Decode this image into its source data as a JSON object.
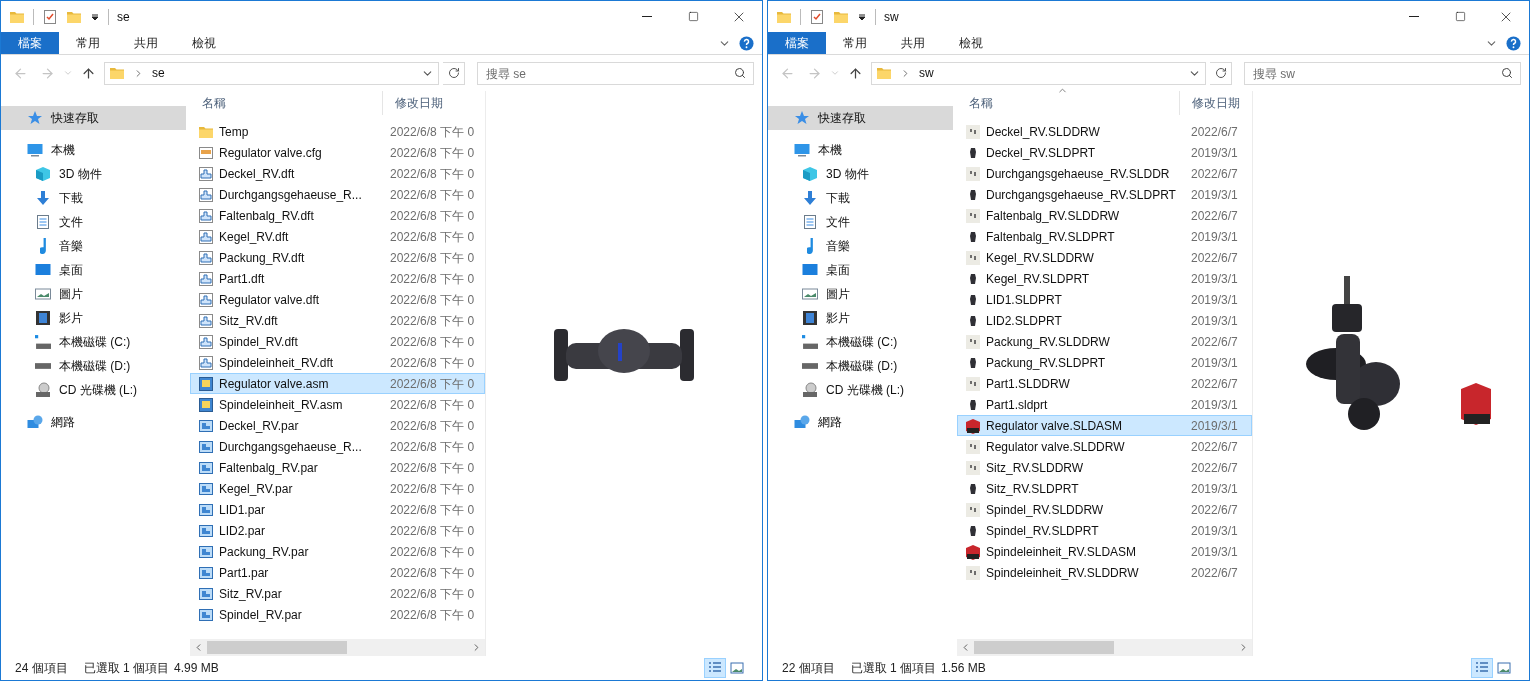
{
  "windows": [
    {
      "title": "se",
      "ribbon_tabs": [
        {
          "label": "檔案",
          "kind": "file"
        },
        {
          "label": "常用",
          "kind": "tab"
        },
        {
          "label": "共用",
          "kind": "tab"
        },
        {
          "label": "檢視",
          "kind": "tab"
        }
      ],
      "address": {
        "path": "se"
      },
      "search": {
        "placeholder": "搜尋 se"
      },
      "nav": [
        {
          "label": "快速存取",
          "kind": "quick",
          "selected": true
        },
        {
          "label": "本機",
          "kind": "pc",
          "selected": false,
          "children": [
            {
              "label": "3D 物件",
              "kind": "objects3d",
              "selected": false
            },
            {
              "label": "下載",
              "kind": "downloads",
              "selected": false
            },
            {
              "label": "文件",
              "kind": "documents",
              "selected": false
            },
            {
              "label": "音樂",
              "kind": "music",
              "selected": false
            },
            {
              "label": "桌面",
              "kind": "desktop",
              "selected": false
            },
            {
              "label": "圖片",
              "kind": "pictures",
              "selected": false
            },
            {
              "label": "影片",
              "kind": "videos",
              "selected": false
            },
            {
              "label": "本機磁碟 (C:)",
              "kind": "windrive",
              "selected": false
            },
            {
              "label": "本機磁碟 (D:)",
              "kind": "drive",
              "selected": false
            },
            {
              "label": "CD 光碟機 (L:)",
              "kind": "cd",
              "selected": false
            }
          ]
        },
        {
          "label": "網路",
          "kind": "network",
          "selected": false
        }
      ],
      "columns": [
        {
          "label": "名稱",
          "sorted": false
        },
        {
          "label": "修改日期"
        }
      ],
      "files": [
        {
          "name": "Temp",
          "kind": "folder",
          "date": "2022/6/8 下午 0",
          "selected": false
        },
        {
          "name": "Regulator valve.cfg",
          "kind": "cfg",
          "date": "2022/6/8 下午 0",
          "selected": false
        },
        {
          "name": "Deckel_RV.dft",
          "kind": "dft",
          "date": "2022/6/8 下午 0",
          "selected": false
        },
        {
          "name": "Durchgangsgehaeuse_R...",
          "kind": "dft",
          "date": "2022/6/8 下午 0",
          "selected": false
        },
        {
          "name": "Faltenbalg_RV.dft",
          "kind": "dft",
          "date": "2022/6/8 下午 0",
          "selected": false
        },
        {
          "name": "Kegel_RV.dft",
          "kind": "dft",
          "date": "2022/6/8 下午 0",
          "selected": false
        },
        {
          "name": "Packung_RV.dft",
          "kind": "dft",
          "date": "2022/6/8 下午 0",
          "selected": false
        },
        {
          "name": "Part1.dft",
          "kind": "dft",
          "date": "2022/6/8 下午 0",
          "selected": false
        },
        {
          "name": "Regulator valve.dft",
          "kind": "dft",
          "date": "2022/6/8 下午 0",
          "selected": false
        },
        {
          "name": "Sitz_RV.dft",
          "kind": "dft",
          "date": "2022/6/8 下午 0",
          "selected": false
        },
        {
          "name": "Spindel_RV.dft",
          "kind": "dft",
          "date": "2022/6/8 下午 0",
          "selected": false
        },
        {
          "name": "Spindeleinheit_RV.dft",
          "kind": "dft",
          "date": "2022/6/8 下午 0",
          "selected": false
        },
        {
          "name": "Regulator valve.asm",
          "kind": "asm",
          "date": "2022/6/8 下午 0",
          "selected": true
        },
        {
          "name": "Spindeleinheit_RV.asm",
          "kind": "asm",
          "date": "2022/6/8 下午 0",
          "selected": false
        },
        {
          "name": "Deckel_RV.par",
          "kind": "par",
          "date": "2022/6/8 下午 0",
          "selected": false
        },
        {
          "name": "Durchgangsgehaeuse_R...",
          "kind": "par",
          "date": "2022/6/8 下午 0",
          "selected": false
        },
        {
          "name": "Faltenbalg_RV.par",
          "kind": "par",
          "date": "2022/6/8 下午 0",
          "selected": false
        },
        {
          "name": "Kegel_RV.par",
          "kind": "par",
          "date": "2022/6/8 下午 0",
          "selected": false
        },
        {
          "name": "LID1.par",
          "kind": "par",
          "date": "2022/6/8 下午 0",
          "selected": false
        },
        {
          "name": "LID2.par",
          "kind": "par",
          "date": "2022/6/8 下午 0",
          "selected": false
        },
        {
          "name": "Packung_RV.par",
          "kind": "par",
          "date": "2022/6/8 下午 0",
          "selected": false
        },
        {
          "name": "Part1.par",
          "kind": "par",
          "date": "2022/6/8 下午 0",
          "selected": false
        },
        {
          "name": "Sitz_RV.par",
          "kind": "par",
          "date": "2022/6/8 下午 0",
          "selected": false
        },
        {
          "name": "Spindel_RV.par",
          "kind": "par",
          "date": "2022/6/8 下午 0",
          "selected": false
        }
      ],
      "preview": {
        "kind": "horizontal"
      },
      "status": {
        "count": "24 個項目",
        "selection": "已選取 1 個項目",
        "size": "4.99 MB"
      },
      "view_buttons": [
        {
          "kind": "details",
          "selected": true
        },
        {
          "kind": "preview",
          "selected": false
        }
      ]
    },
    {
      "title": "sw",
      "ribbon_tabs": [
        {
          "label": "檔案",
          "kind": "file"
        },
        {
          "label": "常用",
          "kind": "tab"
        },
        {
          "label": "共用",
          "kind": "tab"
        },
        {
          "label": "檢視",
          "kind": "tab"
        }
      ],
      "address": {
        "path": "sw"
      },
      "search": {
        "placeholder": "搜尋 sw"
      },
      "nav": [
        {
          "label": "快速存取",
          "kind": "quick",
          "selected": true
        },
        {
          "label": "本機",
          "kind": "pc",
          "selected": false,
          "children": [
            {
              "label": "3D 物件",
              "kind": "objects3d",
              "selected": false
            },
            {
              "label": "下載",
              "kind": "downloads",
              "selected": false
            },
            {
              "label": "文件",
              "kind": "documents",
              "selected": false
            },
            {
              "label": "音樂",
              "kind": "music",
              "selected": false
            },
            {
              "label": "桌面",
              "kind": "desktop",
              "selected": false
            },
            {
              "label": "圖片",
              "kind": "pictures",
              "selected": false
            },
            {
              "label": "影片",
              "kind": "videos",
              "selected": false
            },
            {
              "label": "本機磁碟 (C:)",
              "kind": "windrive",
              "selected": false
            },
            {
              "label": "本機磁碟 (D:)",
              "kind": "drive",
              "selected": false
            },
            {
              "label": "CD 光碟機 (L:)",
              "kind": "cd",
              "selected": false
            }
          ]
        },
        {
          "label": "網路",
          "kind": "network",
          "selected": false
        }
      ],
      "columns": [
        {
          "label": "名稱",
          "sorted": true
        },
        {
          "label": "修改日期"
        }
      ],
      "files": [
        {
          "name": "Deckel_RV.SLDDRW",
          "kind": "slddrw",
          "date": "2022/6/7",
          "selected": false
        },
        {
          "name": "Deckel_RV.SLDPRT",
          "kind": "sldprt",
          "date": "2019/3/1",
          "selected": false
        },
        {
          "name": "Durchgangsgehaeuse_RV.SLDDR",
          "kind": "slddrw",
          "date": "2022/6/7",
          "selected": false
        },
        {
          "name": "Durchgangsgehaeuse_RV.SLDPRT",
          "kind": "sldprt",
          "date": "2019/3/1",
          "selected": false
        },
        {
          "name": "Faltenbalg_RV.SLDDRW",
          "kind": "slddrw",
          "date": "2022/6/7",
          "selected": false
        },
        {
          "name": "Faltenbalg_RV.SLDPRT",
          "kind": "sldprt",
          "date": "2019/3/1",
          "selected": false
        },
        {
          "name": "Kegel_RV.SLDDRW",
          "kind": "slddrw",
          "date": "2022/6/7",
          "selected": false
        },
        {
          "name": "Kegel_RV.SLDPRT",
          "kind": "sldprt",
          "date": "2019/3/1",
          "selected": false
        },
        {
          "name": "LID1.SLDPRT",
          "kind": "sldprt",
          "date": "2019/3/1",
          "selected": false
        },
        {
          "name": "LID2.SLDPRT",
          "kind": "sldprt",
          "date": "2019/3/1",
          "selected": false
        },
        {
          "name": "Packung_RV.SLDDRW",
          "kind": "slddrw",
          "date": "2022/6/7",
          "selected": false
        },
        {
          "name": "Packung_RV.SLDPRT",
          "kind": "sldprt",
          "date": "2019/3/1",
          "selected": false
        },
        {
          "name": "Part1.SLDDRW",
          "kind": "slddrw",
          "date": "2022/6/7",
          "selected": false
        },
        {
          "name": "Part1.sldprt",
          "kind": "sldprt",
          "date": "2019/3/1",
          "selected": false
        },
        {
          "name": "Regulator valve.SLDASM",
          "kind": "sldasm",
          "date": "2019/3/1",
          "selected": true
        },
        {
          "name": "Regulator valve.SLDDRW",
          "kind": "slddrw",
          "date": "2022/6/7",
          "selected": false
        },
        {
          "name": "Sitz_RV.SLDDRW",
          "kind": "slddrw",
          "date": "2022/6/7",
          "selected": false
        },
        {
          "name": "Sitz_RV.SLDPRT",
          "kind": "sldprt",
          "date": "2019/3/1",
          "selected": false
        },
        {
          "name": "Spindel_RV.SLDDRW",
          "kind": "slddrw",
          "date": "2022/6/7",
          "selected": false
        },
        {
          "name": "Spindel_RV.SLDPRT",
          "kind": "sldprt",
          "date": "2019/3/1",
          "selected": false
        },
        {
          "name": "Spindeleinheit_RV.SLDASM",
          "kind": "sldasm",
          "date": "2019/3/1",
          "selected": false
        },
        {
          "name": "Spindeleinheit_RV.SLDDRW",
          "kind": "slddrw",
          "date": "2022/6/7",
          "selected": false
        }
      ],
      "preview": {
        "kind": "vertical"
      },
      "status": {
        "count": "22 個項目",
        "selection": "已選取 1 個項目",
        "size": "1.56 MB"
      },
      "view_buttons": [
        {
          "kind": "details",
          "selected": true
        },
        {
          "kind": "preview",
          "selected": false
        }
      ]
    }
  ]
}
